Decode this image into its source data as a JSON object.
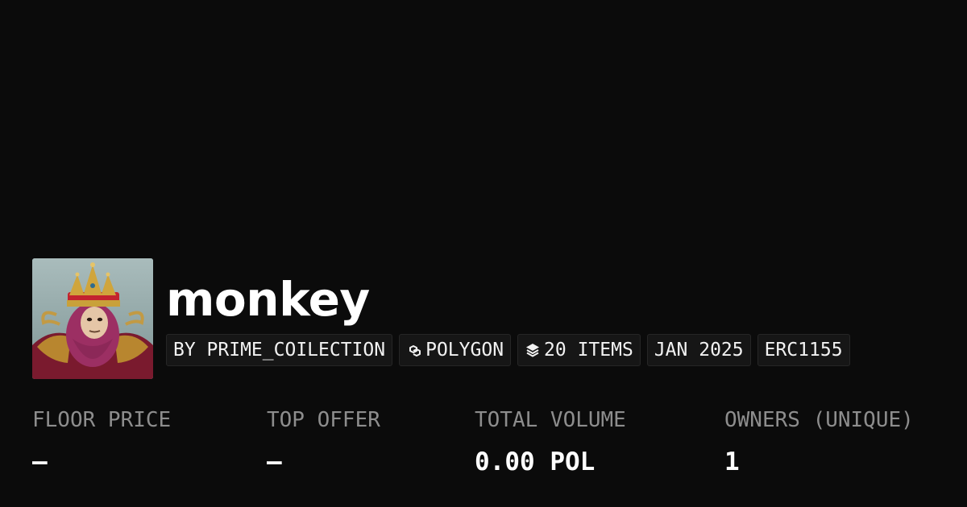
{
  "collection": {
    "name": "monkey",
    "avatar_alt": "monkey-king-avatar"
  },
  "badges": [
    {
      "label": "BY PRIME_COILECTION",
      "icon": ""
    },
    {
      "label": "POLYGON",
      "icon": "polygon-chain-icon"
    },
    {
      "label": "20 ITEMS",
      "icon": "layers-icon"
    },
    {
      "label": "JAN 2025",
      "icon": ""
    },
    {
      "label": "ERC1155",
      "icon": ""
    }
  ],
  "stats": [
    {
      "label": "FLOOR PRICE",
      "value": "–"
    },
    {
      "label": "TOP OFFER",
      "value": "–"
    },
    {
      "label": "TOTAL VOLUME",
      "value": "0.00 POL"
    },
    {
      "label": "OWNERS (UNIQUE)",
      "value": "1"
    }
  ],
  "colors": {
    "background": "#0b0b0b",
    "badge_background": "#161616",
    "label_gray": "#8d8d8d",
    "text": "#ffffff"
  }
}
